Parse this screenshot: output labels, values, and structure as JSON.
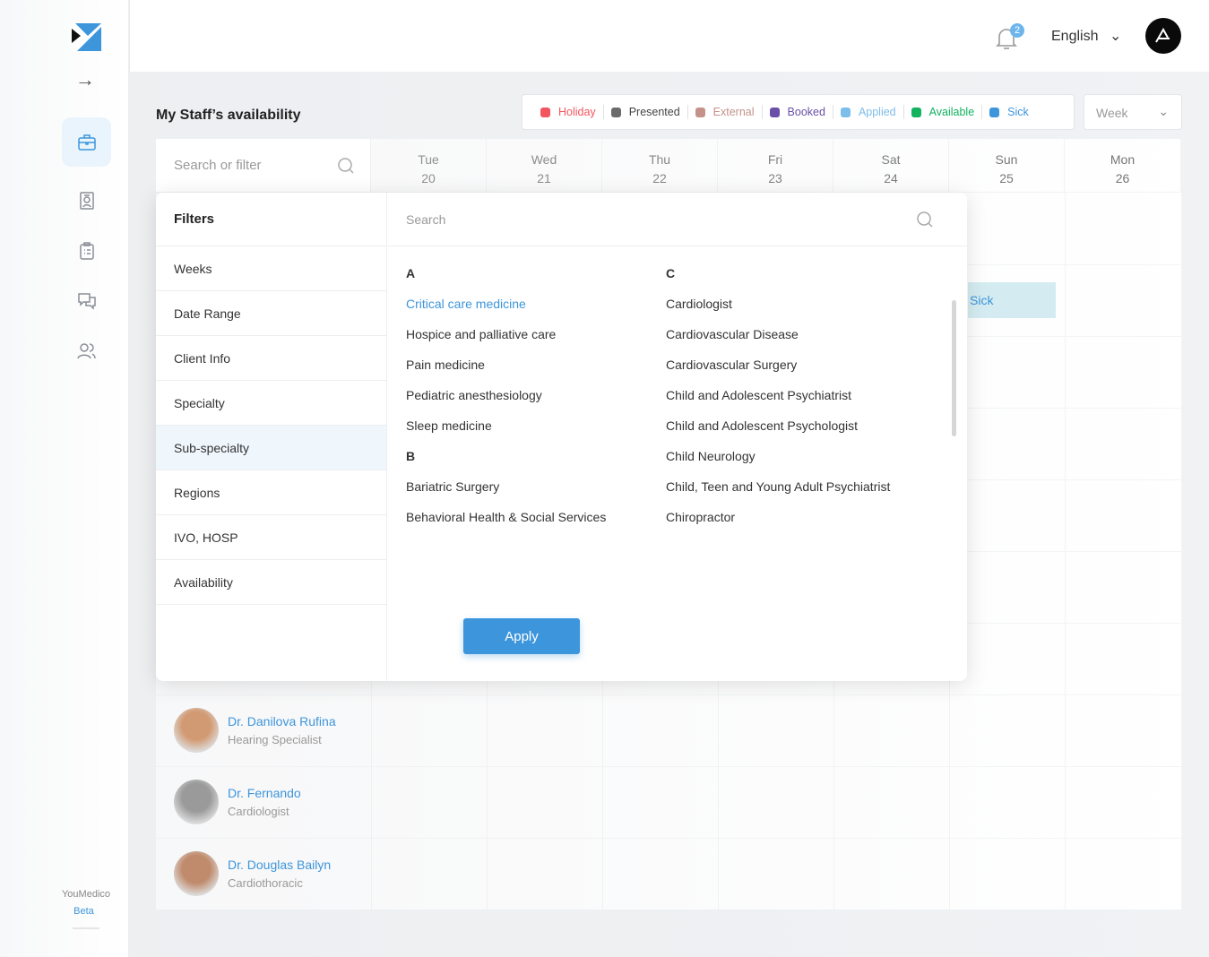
{
  "sidebar": {
    "nav": [
      "briefcase-icon",
      "contact-card-icon",
      "clipboard-icon",
      "chat-icon",
      "users-icon"
    ],
    "brand": "YouMedico",
    "beta": "Beta"
  },
  "header": {
    "notifications": "2",
    "language": "English"
  },
  "page": {
    "title": "My Staff’s availability"
  },
  "legend": [
    {
      "label": "Holiday",
      "color": "#f2555f"
    },
    {
      "label": "Presented",
      "color": "#6b6b6b"
    },
    {
      "label": "External",
      "color": "#c4928a"
    },
    {
      "label": "Booked",
      "color": "#6a4fa8"
    },
    {
      "label": "Applied",
      "color": "#7cbde9"
    },
    {
      "label": "Available",
      "color": "#12b25f"
    },
    {
      "label": "Sick",
      "color": "#3d95db"
    }
  ],
  "view_select": "Week",
  "grid": {
    "search_placeholder": "Search or filter",
    "days": [
      {
        "d": "Tue",
        "n": "20"
      },
      {
        "d": "Wed",
        "n": "21"
      },
      {
        "d": "Thu",
        "n": "22"
      },
      {
        "d": "Fri",
        "n": "23"
      },
      {
        "d": "Sat",
        "n": "24"
      },
      {
        "d": "Sun",
        "n": "25"
      },
      {
        "d": "Mon",
        "n": "26"
      }
    ],
    "sick_label": "Sick",
    "staff": [
      {
        "name": "Dr. Danilova Rufina",
        "role": "Hearing Specialist"
      },
      {
        "name": "Dr. Fernando",
        "role": "Cardiologist"
      },
      {
        "name": "Dr. Douglas Bailyn",
        "role": "Cardiothoracic"
      }
    ]
  },
  "filters": {
    "title": "Filters",
    "items": [
      "Weeks",
      "Date Range",
      "Client Info",
      "Specialty",
      "Sub-specialty",
      "Regions",
      "IVO, HOSP",
      "Availability"
    ],
    "selected": "Sub-specialty",
    "search_placeholder": "Search",
    "col1": [
      {
        "t": "A",
        "h": true
      },
      {
        "t": "Critical care medicine",
        "a": true
      },
      {
        "t": "Hospice and palliative care"
      },
      {
        "t": "Pain medicine"
      },
      {
        "t": "Pediatric anesthesiology"
      },
      {
        "t": "Sleep medicine"
      },
      {
        "t": "B",
        "h": true
      },
      {
        "t": "Bariatric Surgery"
      },
      {
        "t": "Behavioral Health & Social Services"
      }
    ],
    "col2": [
      {
        "t": "C",
        "h": true
      },
      {
        "t": "Cardiologist"
      },
      {
        "t": "Cardiovascular Disease"
      },
      {
        "t": "Cardiovascular Surgery"
      },
      {
        "t": "Child and Adolescent Psychiatrist"
      },
      {
        "t": "Child and Adolescent Psychologist"
      },
      {
        "t": "Child Neurology"
      },
      {
        "t": "Child, Teen and Young Adult Psychiatrist"
      },
      {
        "t": "Chiropractor"
      }
    ],
    "apply": "Apply"
  }
}
